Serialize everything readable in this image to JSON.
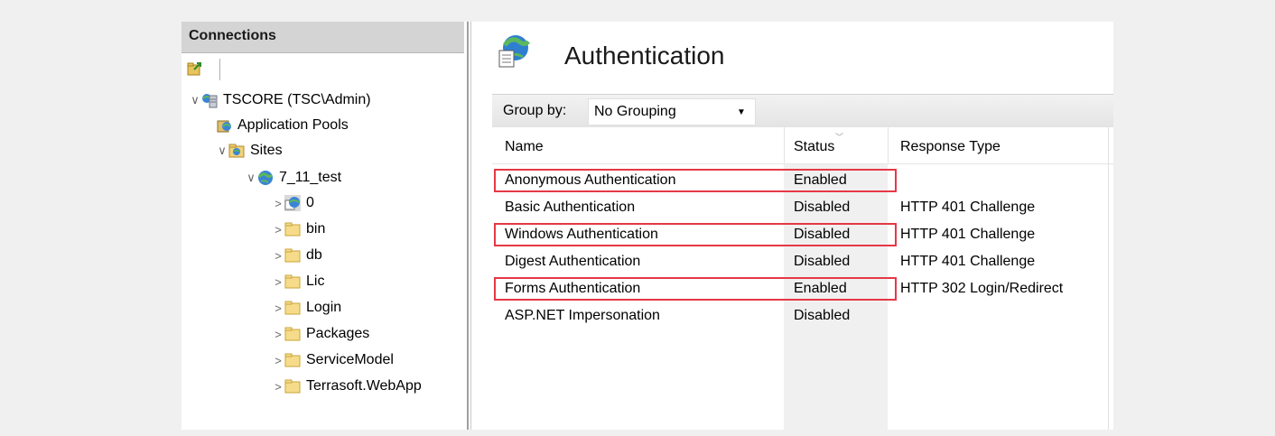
{
  "connections": {
    "title": "Connections",
    "tree": [
      {
        "label": "TSCORE (TSC\\Admin)",
        "icon": "server-icon",
        "expander": "∨"
      },
      {
        "label": "Application Pools",
        "icon": "app-pools-icon",
        "expander": ""
      },
      {
        "label": "Sites",
        "icon": "sites-folder-icon",
        "expander": "∨"
      },
      {
        "label": "7_11_test",
        "icon": "globe-icon",
        "expander": "∨"
      },
      {
        "label": "0",
        "icon": "web-app-icon",
        "expander": ">"
      },
      {
        "label": "bin",
        "icon": "folder-icon",
        "expander": ">"
      },
      {
        "label": "db",
        "icon": "folder-icon",
        "expander": ">"
      },
      {
        "label": "Lic",
        "icon": "folder-icon",
        "expander": ">"
      },
      {
        "label": "Login",
        "icon": "folder-icon",
        "expander": ">"
      },
      {
        "label": "Packages",
        "icon": "folder-icon",
        "expander": ">"
      },
      {
        "label": "ServiceModel",
        "icon": "folder-icon",
        "expander": ">"
      },
      {
        "label": "Terrasoft.WebApp",
        "icon": "folder-icon",
        "expander": ">"
      }
    ]
  },
  "feature": {
    "title": "Authentication",
    "icon": "authentication-globe-icon",
    "group_by_label": "Group by:",
    "group_by_value": "No Grouping",
    "columns": [
      "Name",
      "Status",
      "Response Type"
    ],
    "rows": [
      {
        "name": "Anonymous Authentication",
        "status": "Enabled",
        "response": "",
        "highlighted": true
      },
      {
        "name": "Basic Authentication",
        "status": "Disabled",
        "response": "HTTP 401 Challenge",
        "highlighted": false
      },
      {
        "name": "Windows Authentication",
        "status": "Disabled",
        "response": "HTTP 401 Challenge",
        "highlighted": true
      },
      {
        "name": "Digest Authentication",
        "status": "Disabled",
        "response": "HTTP 401 Challenge",
        "highlighted": false
      },
      {
        "name": "Forms Authentication",
        "status": "Enabled",
        "response": "HTTP 302 Login/Redirect",
        "highlighted": true
      },
      {
        "name": "ASP.NET Impersonation",
        "status": "Disabled",
        "response": "",
        "highlighted": false
      }
    ]
  },
  "colors": {
    "highlight": "#e53845",
    "panel_header": "#d4d4d4",
    "status_column": "#f0f0f0"
  }
}
